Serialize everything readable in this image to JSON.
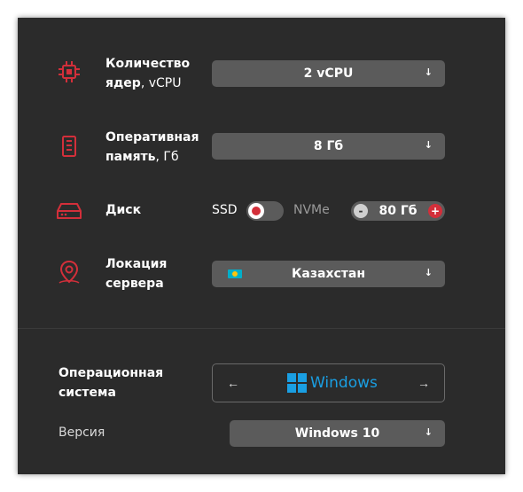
{
  "colors": {
    "panel_bg": "#2b2b2b",
    "control_bg": "#5b5b5b",
    "accent_red": "#d32f3a",
    "windows_blue": "#1a9fe3"
  },
  "cpu": {
    "icon": "cpu-chip-icon",
    "label_bold": "Количество ядер",
    "label_suffix": ", vCPU",
    "value": "2 vCPU"
  },
  "ram": {
    "icon": "memory-module-icon",
    "label_bold": "Оперативная память",
    "label_suffix": ", Гб",
    "value": "8 Гб"
  },
  "disk": {
    "icon": "hard-drive-icon",
    "label": "Диск",
    "type_left": "SSD",
    "type_right": "NVMe",
    "selected_type": "SSD",
    "size_value": "80 Гб",
    "minus": "-",
    "plus": "+"
  },
  "location": {
    "icon": "location-pin-icon",
    "label": "Локация сервера",
    "value": "Казахстан",
    "flag": "kazakhstan-flag-icon"
  },
  "os": {
    "label": "Операционная система",
    "value": "Windows",
    "prev": "←",
    "next": "→",
    "logo": "windows-logo-icon"
  },
  "version": {
    "label": "Версия",
    "value": "Windows 10"
  },
  "dropdown_arrow": "↓"
}
